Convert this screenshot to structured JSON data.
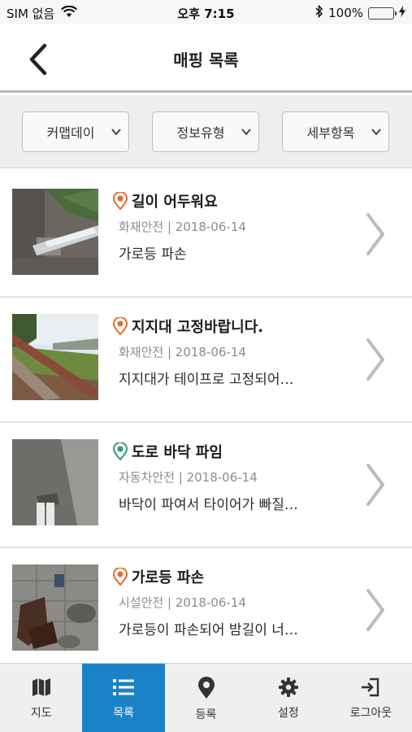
{
  "status_bar": {
    "carrier": "SIM 없음",
    "time": "오후 7:15",
    "battery_percent": "100%",
    "battery_level": 1.0
  },
  "header": {
    "title": "매핑 목록"
  },
  "filters": [
    {
      "label": "커맵데이"
    },
    {
      "label": "정보유형"
    },
    {
      "label": "세부항목"
    }
  ],
  "items": [
    {
      "title": "길이 어두워요",
      "meta": "화재안전 | 2018-06-14",
      "description": "가로등 파손",
      "pin_color": "#e4692a",
      "pin_icon": "map-pin-icon"
    },
    {
      "title": "지지대 고정바랍니다.",
      "meta": "화재안전 | 2018-06-14",
      "description": "지지대가 테이프로 고정되어…",
      "pin_color": "#e4692a",
      "pin_icon": "map-pin-icon"
    },
    {
      "title": "도로 바닥 파임",
      "meta": "자동차안전 | 2018-06-14",
      "description": "바닥이 파여서 타이어가 빠질…",
      "pin_color": "#2d9a78",
      "pin_icon": "map-pin-icon"
    },
    {
      "title": "가로등 파손",
      "meta": "시설안전 | 2018-06-14",
      "description": "가로등이 파손되어 밤길이 너…",
      "pin_color": "#e4692a",
      "pin_icon": "map-pin-icon"
    }
  ],
  "tabbar": {
    "tabs": [
      {
        "label": "지도",
        "icon": "map-icon",
        "active": false
      },
      {
        "label": "목록",
        "icon": "list-icon",
        "active": true
      },
      {
        "label": "등록",
        "icon": "location-pin-icon",
        "active": false
      },
      {
        "label": "설정",
        "icon": "gear-icon",
        "active": false
      },
      {
        "label": "로그아웃",
        "icon": "logout-icon",
        "active": false
      }
    ],
    "active_color": "#1a82c8"
  }
}
